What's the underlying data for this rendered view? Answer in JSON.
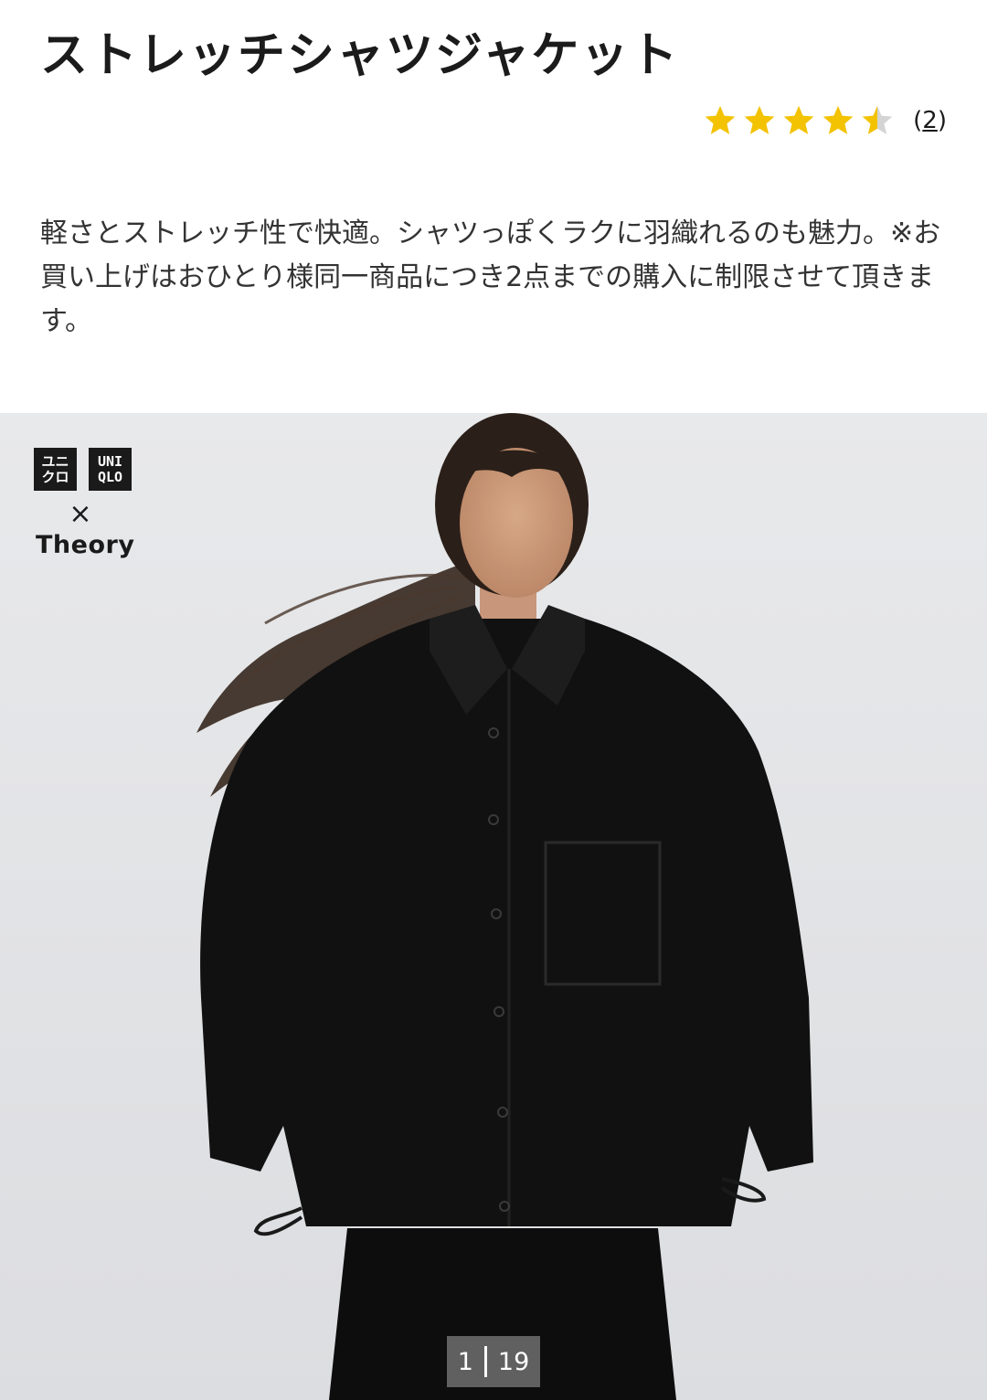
{
  "product": {
    "title": "ストレッチシャツジャケット",
    "rating": {
      "value": 4.5,
      "max": 5,
      "count_open": "(",
      "count": "2",
      "count_close": ")",
      "star_color": "#f3c200",
      "star_empty_color": "#d4d4d4"
    },
    "description": "軽さとストレッチ性で快適。シャツっぽくラクに羽織れるのも魅力。※お買い上げはおひとり様同一商品につき2点までの購入に制限させて頂きます。"
  },
  "hero": {
    "logo": {
      "box1_top": "ユニ",
      "box1_bottom": "クロ",
      "box2_top": "UNI",
      "box2_bottom": "QLO",
      "x": "×",
      "brand": "Theory"
    },
    "pager": {
      "current": "1",
      "total": "19"
    }
  }
}
